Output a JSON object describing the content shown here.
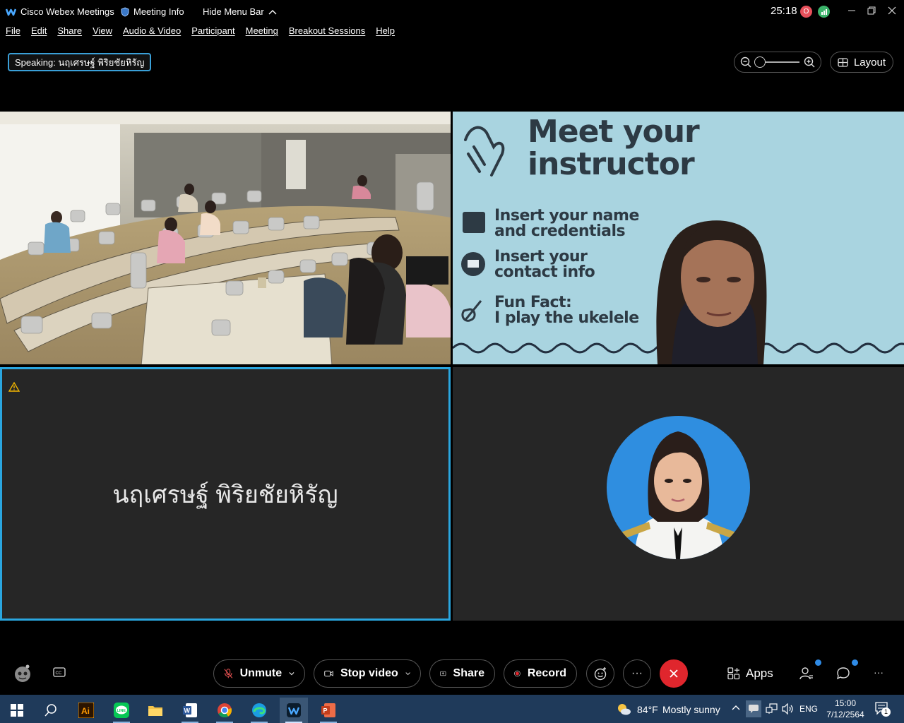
{
  "titlebar": {
    "app_name": "Cisco Webex Meetings",
    "meeting_info": "Meeting Info",
    "hide_menu": "Hide Menu Bar",
    "timer": "25:18",
    "rec_badge": "O"
  },
  "menubar": {
    "items": [
      "File",
      "Edit",
      "Share",
      "View",
      "Audio & Video",
      "Participant",
      "Meeting",
      "Breakout Sessions",
      "Help"
    ]
  },
  "speaking": {
    "label": "Speaking:",
    "name": "นฤเศรษฐ์ พิริยชัยหิรัญ"
  },
  "layout_button": "Layout",
  "zoom": {
    "level": 0.0
  },
  "slide": {
    "title_line1": "Meet your",
    "title_line2": "instructor",
    "item1_line1": "Insert your name",
    "item1_line2": "and credentials",
    "item2_line1": "Insert your",
    "item2_line2": "contact info",
    "item3_line1": "Fun Fact:",
    "item3_line2": "I play the ukelele"
  },
  "tile3": {
    "name": "นฤเศรษฐ์ พิริยชัยหิรัญ"
  },
  "toolbar": {
    "unmute": "Unmute",
    "stop_video": "Stop video",
    "share": "Share",
    "record": "Record",
    "more": "···",
    "apps": "Apps",
    "overflow": "···"
  },
  "taskbar": {
    "weather_temp": "84°F",
    "weather_text": "Mostly sunny",
    "lang": "ENG",
    "time": "15:00",
    "date": "7/12/2564",
    "notif_count": "1"
  },
  "colors": {
    "accent_blue": "#2aa6df",
    "end_red": "#e0262d",
    "record_red": "#e0262d",
    "taskbar": "#1f3a5a"
  }
}
